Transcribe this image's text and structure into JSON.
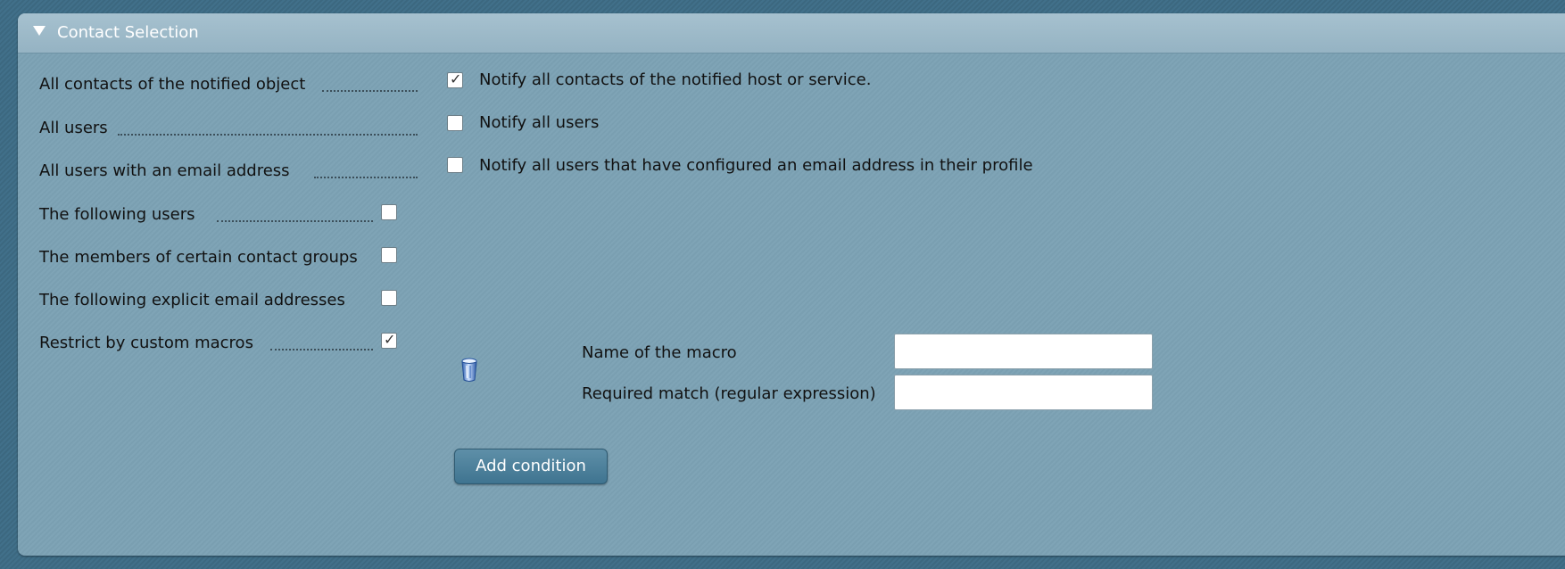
{
  "section": {
    "title": "Contact Selection",
    "collapse_icon": "triangle-down-icon"
  },
  "rows": [
    {
      "label": "All contacts of the notified object",
      "checked": true,
      "option_text": "Notify all contacts of the notified host or service."
    },
    {
      "label": "All users",
      "checked": false,
      "option_text": "Notify all users"
    },
    {
      "label": "All users with an email address",
      "checked": false,
      "option_text": "Notify all users that have configured an email address in their profile"
    },
    {
      "label": "The following users",
      "checked": false
    },
    {
      "label": "The members of certain contact groups",
      "checked": false
    },
    {
      "label": "The following explicit email addresses",
      "checked": false
    },
    {
      "label": "Restrict by custom macros",
      "checked": true
    }
  ],
  "macro": {
    "delete_icon": "trash-icon",
    "name_label": "Name of the macro",
    "name_value": "",
    "match_label": "Required match (regular expression)",
    "match_value": ""
  },
  "add_condition_label": "Add condition",
  "colors": {
    "panel_bg": "#7fa4b6",
    "header_bg": "#a6c1cf",
    "button_bg": "#4a7f9b"
  }
}
